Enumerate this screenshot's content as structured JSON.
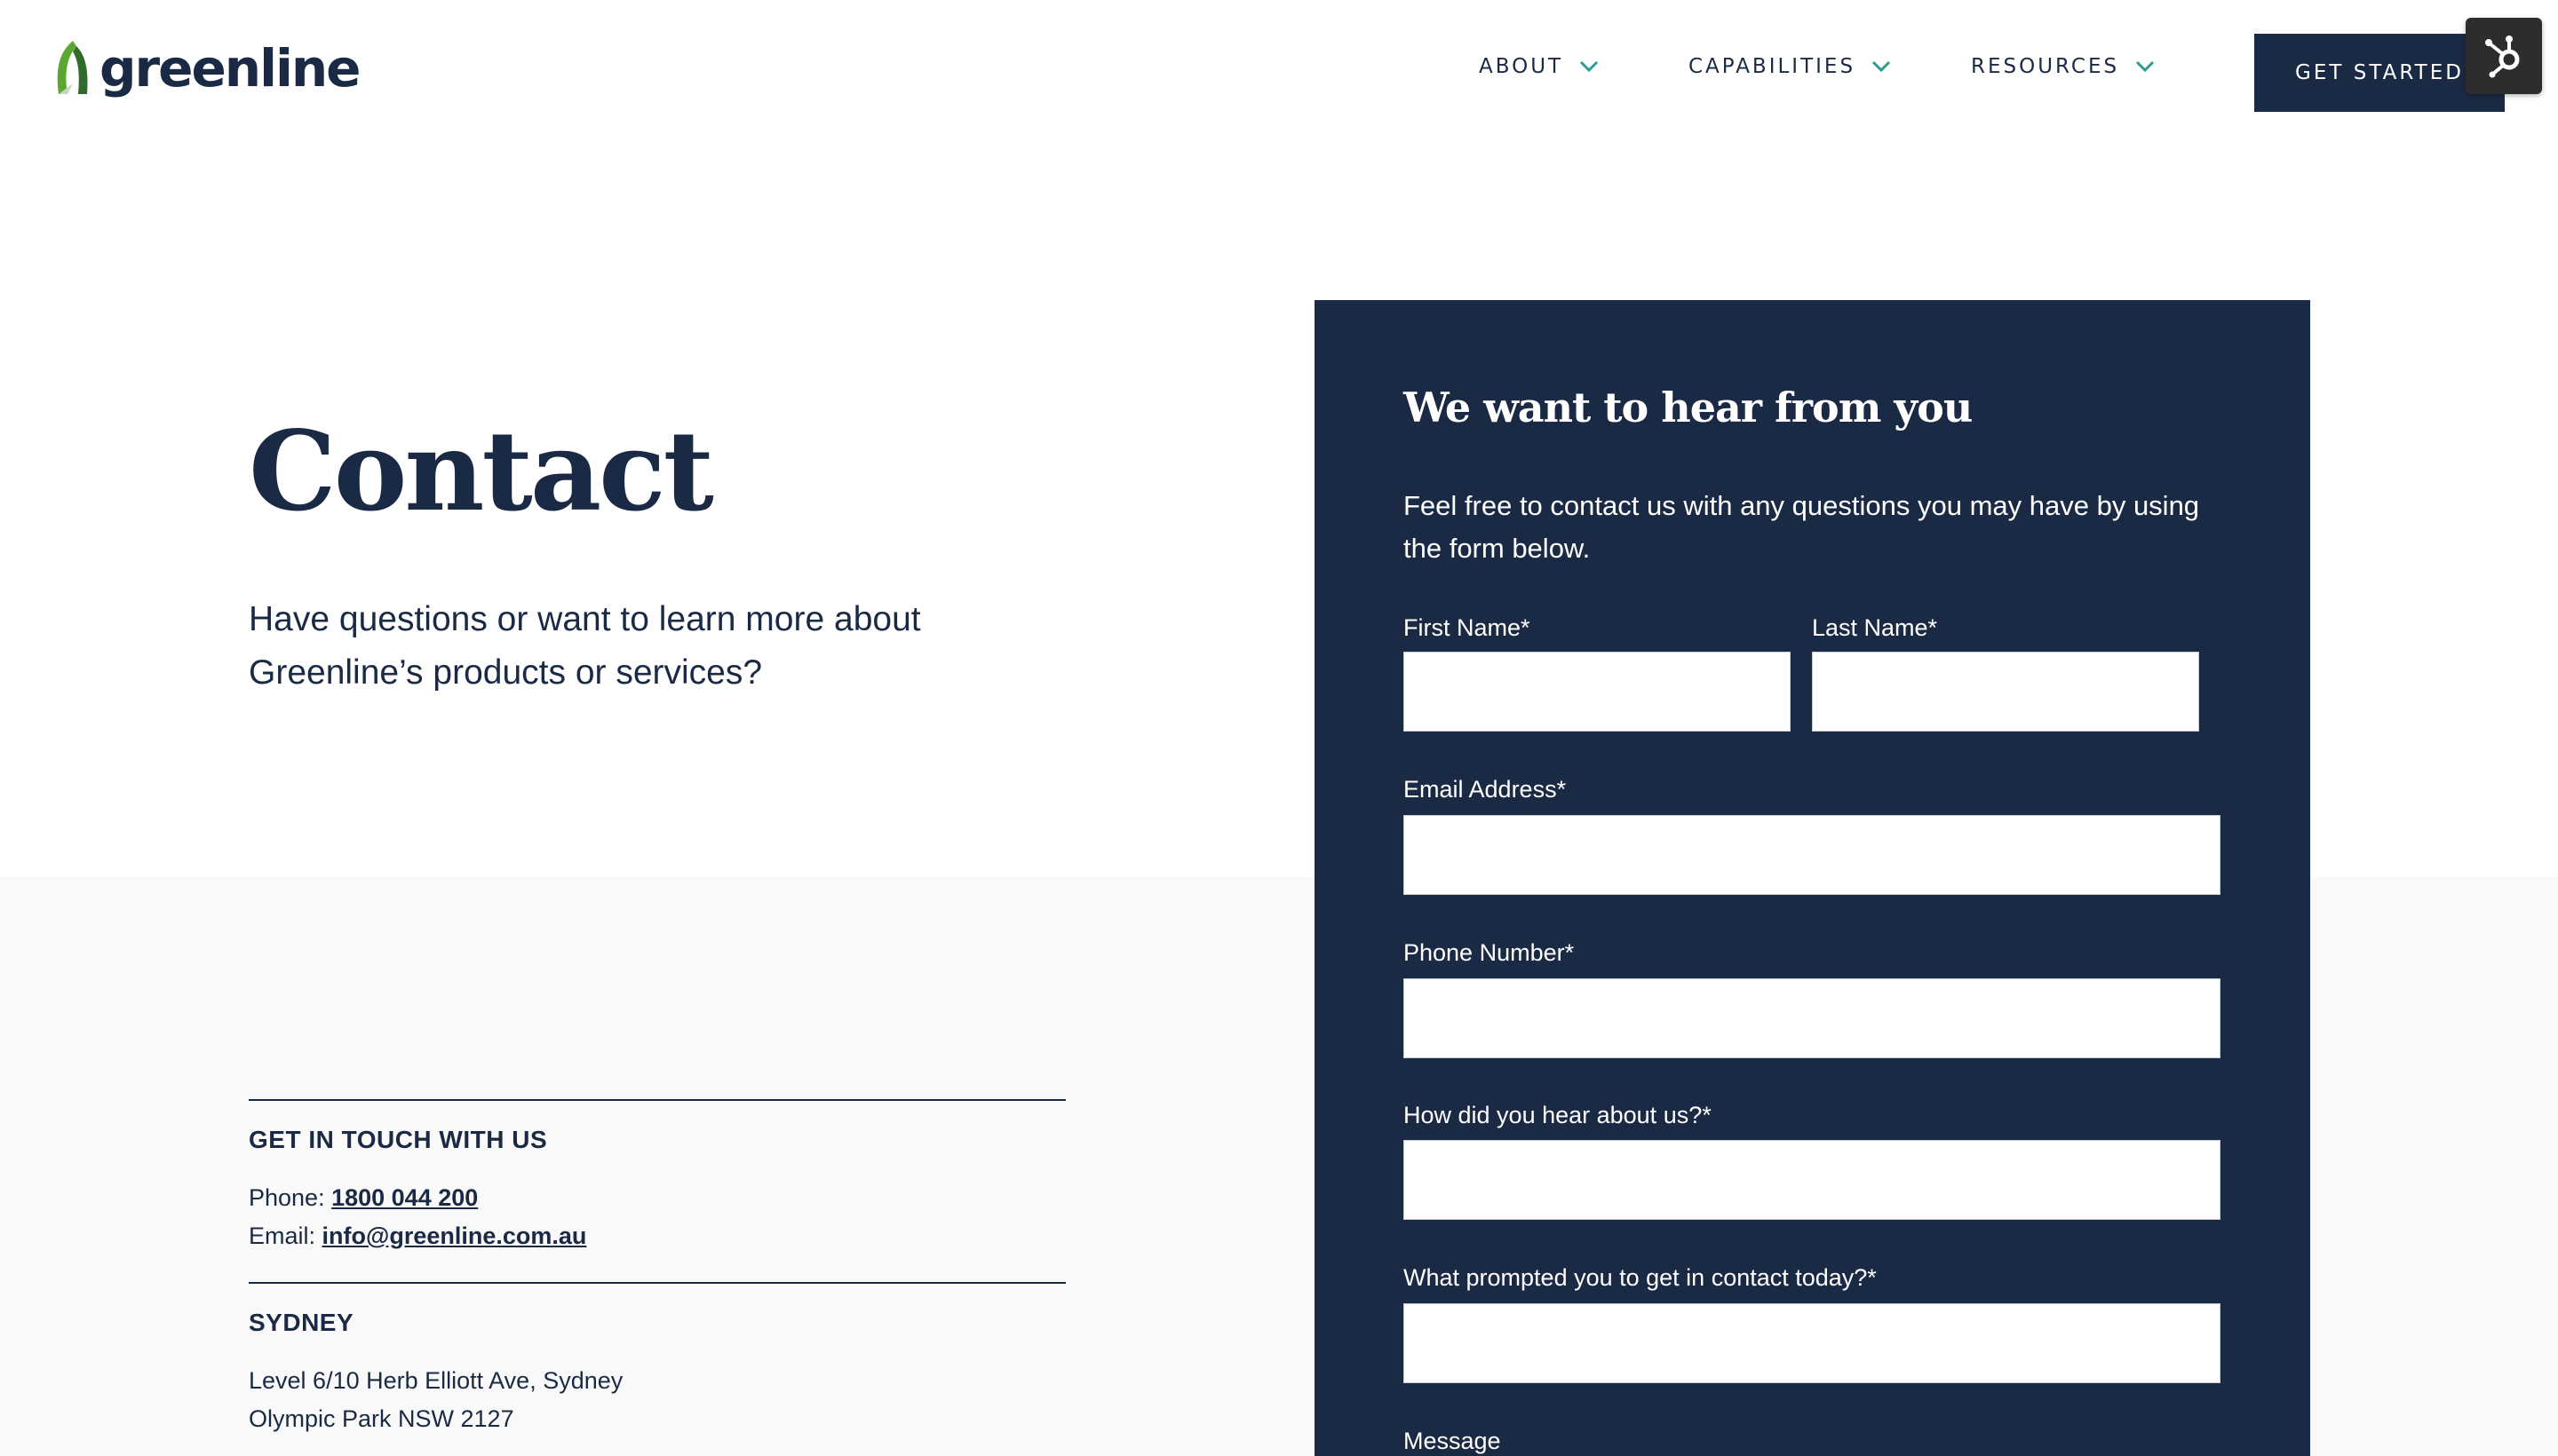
{
  "header": {
    "brand": "greenline",
    "nav": [
      {
        "label": "ABOUT"
      },
      {
        "label": "CAPABILITIES"
      },
      {
        "label": "RESOURCES"
      }
    ],
    "cta_label": "GET STARTED",
    "widget_icon": "hubspot-sprocket-icon"
  },
  "hero": {
    "title": "Contact",
    "intro": "Have questions or want to learn more about Greenline’s products or services?"
  },
  "contact": {
    "heading": "GET IN TOUCH WITH US",
    "phone_label": "Phone:",
    "phone": "1800 044 200",
    "email_label": "Email:",
    "email": "info@greenline.com.au",
    "office_heading": "SYDNEY",
    "address_line1": "Level 6/10 Herb Elliott Ave, Sydney",
    "address_line2": "Olympic Park NSW 2127"
  },
  "form": {
    "title": "We want to hear from you",
    "description": "Feel free to contact us with any questions you may have by using the form below.",
    "fields": {
      "first_name": {
        "label": "First Name*",
        "value": ""
      },
      "last_name": {
        "label": "Last Name*",
        "value": ""
      },
      "email": {
        "label": "Email Address*",
        "value": ""
      },
      "phone": {
        "label": "Phone Number*",
        "value": ""
      },
      "source": {
        "label": "How did you hear about us?*",
        "value": ""
      },
      "reason": {
        "label": "What prompted you to get in contact today?*",
        "value": ""
      },
      "message": {
        "label": "Message"
      }
    }
  },
  "colors": {
    "navy": "#1b2a44",
    "accent_green": "#5aa832",
    "chevron_teal": "#2a9d8f",
    "band_gray": "#f9f9f9"
  }
}
